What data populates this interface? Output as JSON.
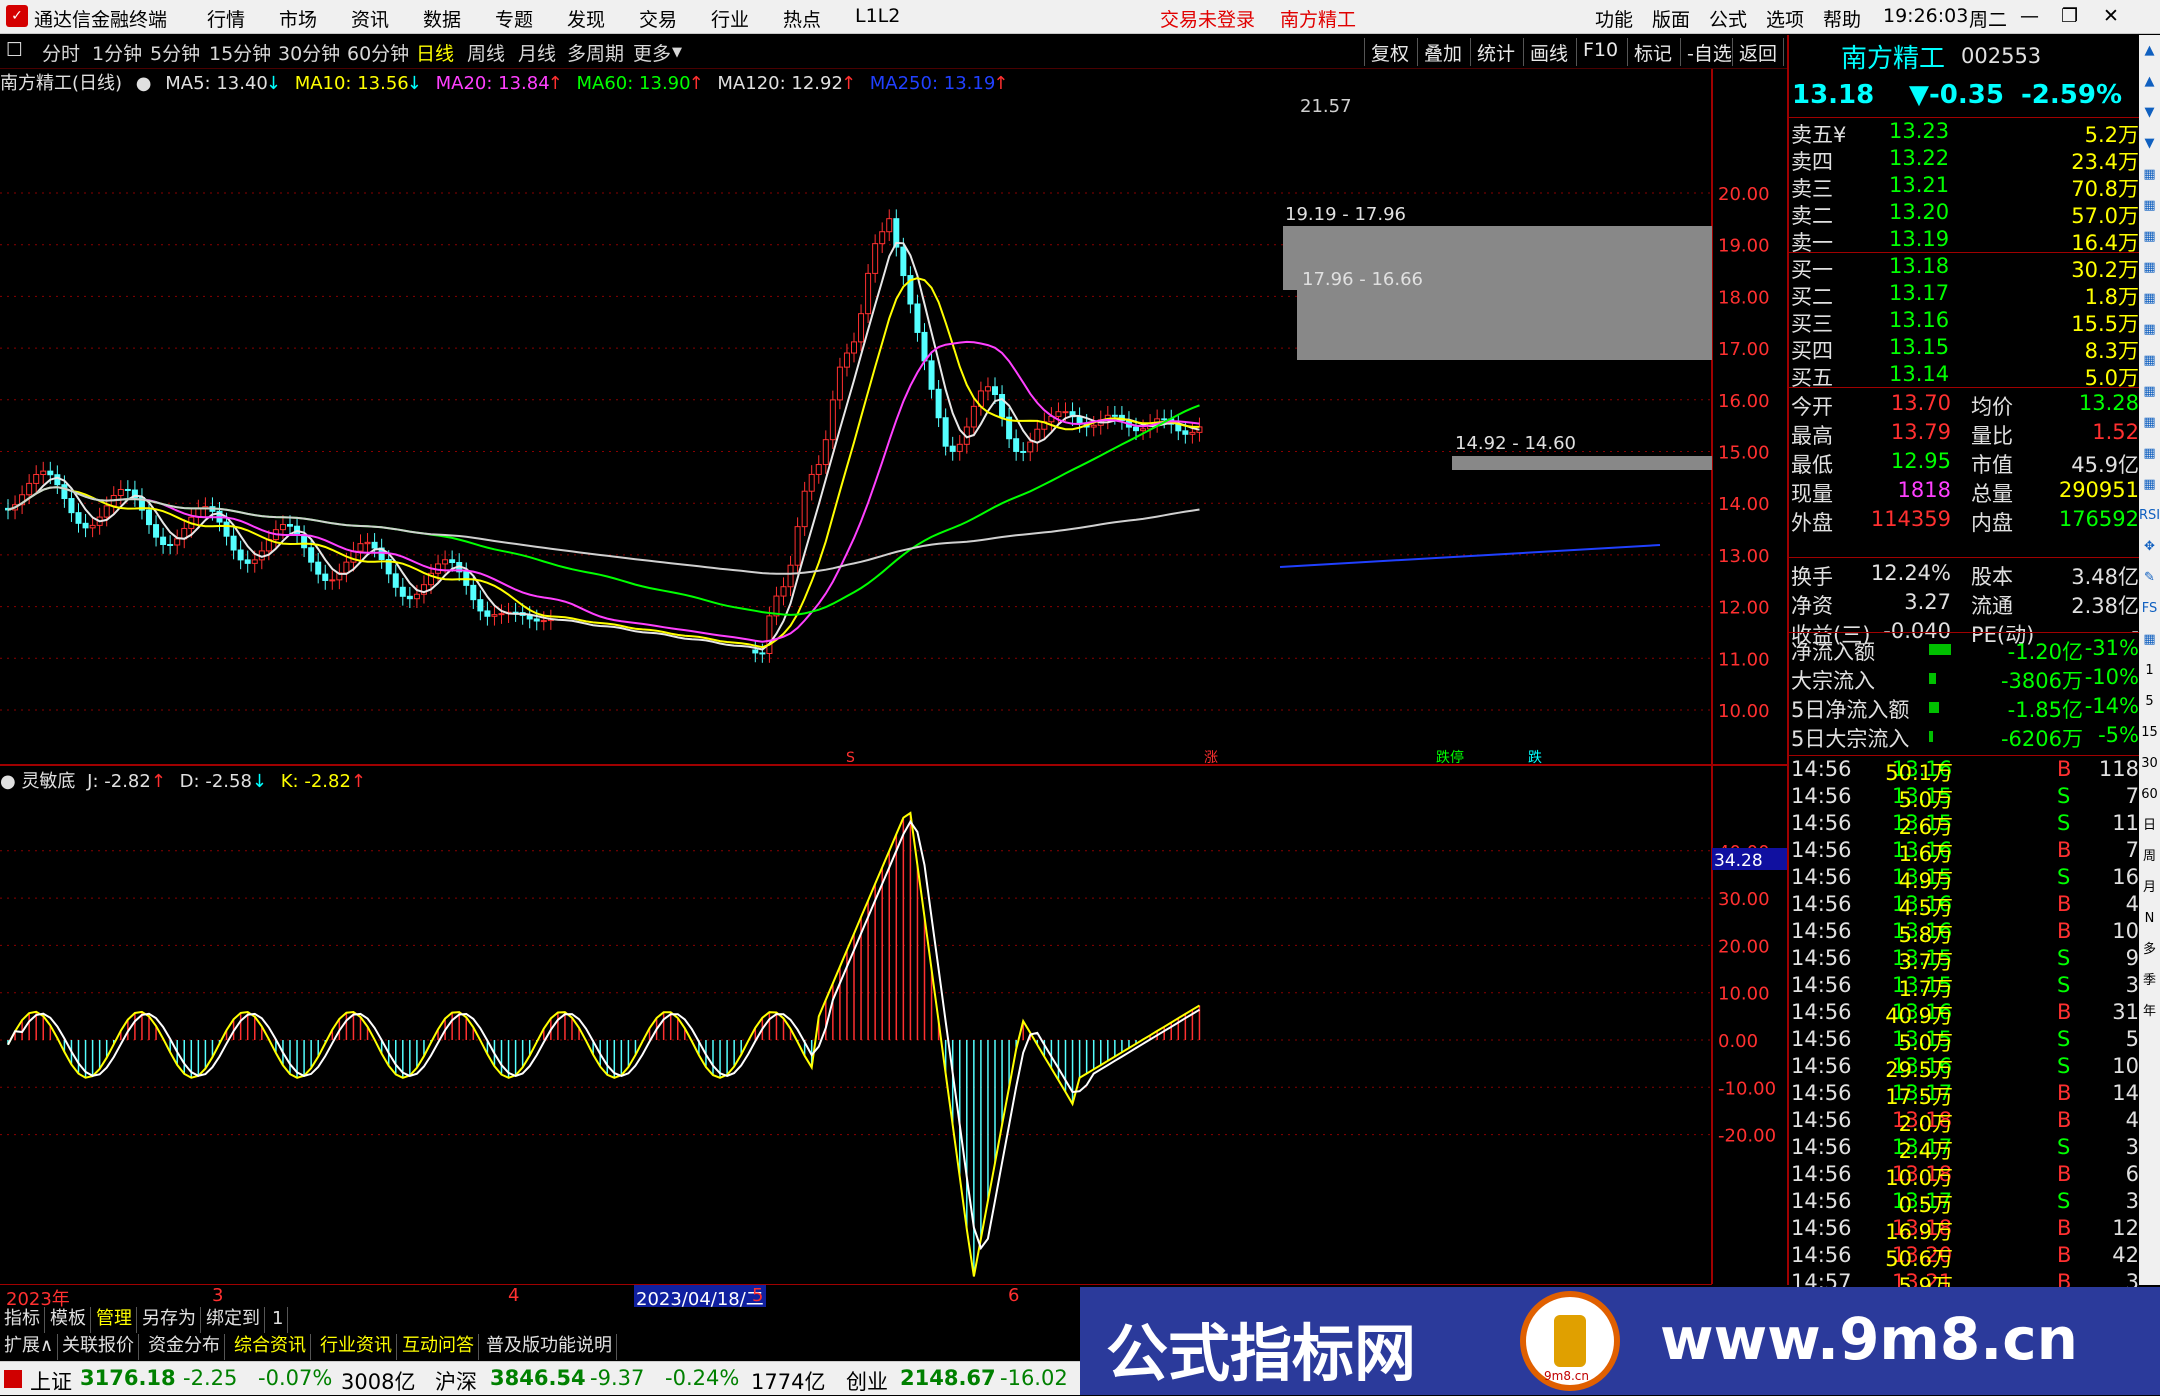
{
  "menubar": {
    "app_title": "通达信金融终端",
    "menus": [
      "行情",
      "市场",
      "资讯",
      "数据",
      "专题",
      "发现",
      "交易",
      "行业",
      "热点",
      "L1L2"
    ],
    "status_trade": "交易未登录",
    "status_stock": "南方精工",
    "right_menus": [
      "功能",
      "版面",
      "公式",
      "选项",
      "帮助"
    ],
    "clock": "19:26:03",
    "weekday": "周二"
  },
  "periods": [
    "分时",
    "1分钟",
    "5分钟",
    "15分钟",
    "30分钟",
    "60分钟",
    "日线",
    "周线",
    "月线",
    "多周期",
    "更多"
  ],
  "active_period": "日线",
  "tools": [
    "复权",
    "叠加",
    "统计",
    "画线",
    "F10",
    "标记",
    "-自选",
    "返回"
  ],
  "main_legend": {
    "title": "南方精工(日线)",
    "ma5": "MA5: 13.40",
    "ma10": "MA10: 13.56",
    "ma20": "MA20: 13.84",
    "ma60": "MA60: 13.90",
    "ma120": "MA120: 12.92",
    "ma250": "MA250: 13.19"
  },
  "price_axis": [
    "20.00",
    "19.00",
    "18.00",
    "17.00",
    "16.00",
    "15.00",
    "14.00",
    "13.00",
    "12.00",
    "11.00",
    "10.00"
  ],
  "annotations": {
    "high": "21.57",
    "gap1": "19.19 - 17.96",
    "gap2": "17.96 - 16.66",
    "gap3": "14.92 - 14.60"
  },
  "signals": [
    "S",
    "涨",
    "跌停",
    "跌"
  ],
  "indicator_legend": {
    "name": "灵敏底",
    "j": "J: -2.82",
    "d": "D: -2.58",
    "k": "K: -2.82"
  },
  "indicator_axis": [
    "40.00",
    "30.00",
    "20.00",
    "10.00",
    "0.00",
    "-10.00",
    "-20.00"
  ],
  "indicator_current": "34.28",
  "date_axis": [
    "2023年",
    "3",
    "4",
    "2023/04/18/二",
    "5",
    "6"
  ],
  "stock": {
    "name": "南方精工",
    "code": "002553",
    "price": "13.18",
    "change": "▼-0.35",
    "pct": "-2.59%"
  },
  "asks": [
    {
      "label": "卖五",
      "flag": "¥",
      "price": "13.23",
      "vol": "5.2万"
    },
    {
      "label": "卖四",
      "flag": "",
      "price": "13.22",
      "vol": "23.4万"
    },
    {
      "label": "卖三",
      "flag": "",
      "price": "13.21",
      "vol": "70.8万"
    },
    {
      "label": "卖二",
      "flag": "",
      "price": "13.20",
      "vol": "57.0万"
    },
    {
      "label": "卖一",
      "flag": "",
      "price": "13.19",
      "vol": "16.4万"
    }
  ],
  "bids": [
    {
      "label": "买一",
      "price": "13.18",
      "vol": "30.2万"
    },
    {
      "label": "买二",
      "price": "13.17",
      "vol": "1.8万"
    },
    {
      "label": "买三",
      "price": "13.16",
      "vol": "15.5万"
    },
    {
      "label": "买四",
      "price": "13.15",
      "vol": "8.3万"
    },
    {
      "label": "买五",
      "price": "13.14",
      "vol": "5.0万"
    }
  ],
  "stats": [
    {
      "l1": "今开",
      "v1": "13.70",
      "l2": "均价",
      "v2": "13.28"
    },
    {
      "l1": "最高",
      "v1": "13.79",
      "l2": "量比",
      "v2": "1.52"
    },
    {
      "l1": "最低",
      "v1": "12.95",
      "l2": "市值",
      "v2": "45.9亿"
    },
    {
      "l1": "现量",
      "v1": "1818",
      "l2": "总量",
      "v2": "290951"
    },
    {
      "l1": "外盘",
      "v1": "114359",
      "l2": "内盘",
      "v2": "176592"
    }
  ],
  "stats2": [
    {
      "l1": "换手",
      "v1": "12.24%",
      "l2": "股本",
      "v2": "3.48亿"
    },
    {
      "l1": "净资",
      "v1": "3.27",
      "l2": "流通",
      "v2": "2.38亿"
    },
    {
      "l1": "收益(三)",
      "v1": "-0.040",
      "l2": "PE(动)",
      "v2": "-"
    }
  ],
  "flows": [
    {
      "label": "净流入额",
      "value": "-1.20亿",
      "pct": "-31%",
      "bar": 0.31
    },
    {
      "label": "大宗流入",
      "value": "-3806万",
      "pct": "-10%",
      "bar": 0.1
    },
    {
      "label": "5日净流入额",
      "value": "-1.85亿",
      "pct": "-14%",
      "bar": 0.14
    },
    {
      "label": "5日大宗流入",
      "value": "-6206万",
      "pct": "-5%",
      "bar": 0.05
    }
  ],
  "ticks": [
    {
      "t": "14:56",
      "p": "13.16",
      "v": "50.1万",
      "d": "B",
      "n": "118"
    },
    {
      "t": "14:56",
      "p": "13.15",
      "v": "5.0万",
      "d": "S",
      "n": "7"
    },
    {
      "t": "14:56",
      "p": "13.15",
      "v": "2.6万",
      "d": "S",
      "n": "11"
    },
    {
      "t": "14:56",
      "p": "13.16",
      "v": "1.6万",
      "d": "B",
      "n": "7"
    },
    {
      "t": "14:56",
      "p": "13.15",
      "v": "4.9万",
      "d": "S",
      "n": "16"
    },
    {
      "t": "14:56",
      "p": "13.16",
      "v": "4.5万",
      "d": "B",
      "n": "4"
    },
    {
      "t": "14:56",
      "p": "13.16",
      "v": "5.8万",
      "d": "B",
      "n": "10"
    },
    {
      "t": "14:56",
      "p": "13.15",
      "v": "3.7万",
      "d": "S",
      "n": "9"
    },
    {
      "t": "14:56",
      "p": "13.15",
      "v": "1.7万",
      "d": "S",
      "n": "3"
    },
    {
      "t": "14:56",
      "p": "13.16",
      "v": "40.9万",
      "d": "B",
      "n": "31"
    },
    {
      "t": "14:56",
      "p": "13.15",
      "v": "5.0万",
      "d": "S",
      "n": "5"
    },
    {
      "t": "14:56",
      "p": "13.16",
      "v": "29.5万",
      "d": "S",
      "n": "10"
    },
    {
      "t": "14:56",
      "p": "13.17",
      "v": "17.5万",
      "d": "B",
      "n": "14"
    },
    {
      "t": "14:56",
      "p": "13.18",
      "v": "2.0万",
      "d": "B",
      "n": "4"
    },
    {
      "t": "14:56",
      "p": "13.17",
      "v": "2.4万",
      "d": "S",
      "n": "3"
    },
    {
      "t": "14:56",
      "p": "13.18",
      "v": "10.0万",
      "d": "B",
      "n": "6"
    },
    {
      "t": "14:56",
      "p": "13.17",
      "v": "0.5万",
      "d": "S",
      "n": "3"
    },
    {
      "t": "14:56",
      "p": "13.18",
      "v": "16.9万",
      "d": "B",
      "n": "12"
    },
    {
      "t": "14:56",
      "p": "13.20",
      "v": "50.6万",
      "d": "B",
      "n": "42"
    },
    {
      "t": "14:57",
      "p": "13.21",
      "v": "5.9万",
      "d": "B",
      "n": "3"
    }
  ],
  "side_icons": [
    "▲",
    "▲",
    "▼",
    "▼",
    "▦",
    "▦",
    "▦",
    "▦",
    "▦",
    "▦",
    "▦",
    "▦",
    "▦",
    "▦",
    "▦",
    "RSI",
    "✥",
    "✎",
    "FS",
    "▦",
    "1",
    "5",
    "15",
    "30",
    "60",
    "日",
    "周",
    "月",
    "N",
    "多",
    "季",
    "年"
  ],
  "bottom_tabs1": [
    "指标",
    "模板",
    "管理",
    "另存为",
    "绑定到",
    "1"
  ],
  "bottom_tabs2": [
    "扩展∧",
    "关联报价",
    "资金分布",
    "综合资讯",
    "行业资讯",
    "互动问答",
    "普及版功能说明"
  ],
  "index_status": [
    {
      "name": "上证",
      "value": "3176.18",
      "chg": "-2.25",
      "pct": "-0.07%",
      "amt": "3008亿"
    },
    {
      "name": "沪深",
      "value": "3846.54",
      "chg": "-9.37",
      "pct": "-0.24%",
      "amt": "1774亿"
    },
    {
      "name": "创业",
      "value": "2148.67",
      "chg": "-16.02",
      "pct": "",
      "amt": ""
    }
  ],
  "watermark": {
    "text": "公式指标网",
    "url": "www.9m8.cn",
    "seal": "9m8.cn"
  }
}
